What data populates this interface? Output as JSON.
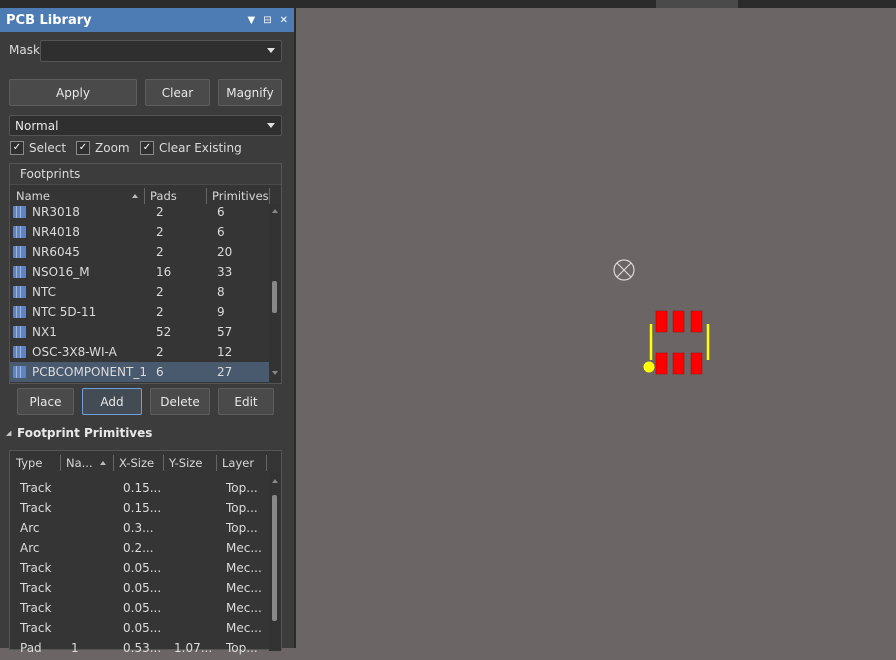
{
  "panel": {
    "title": "PCB Library",
    "controls": [
      "▼",
      "⊟",
      "✕"
    ],
    "mask_label": "Mask",
    "mask_value": "",
    "buttons": {
      "apply": "Apply",
      "clear": "Clear",
      "magnify": "Magnify"
    },
    "mode_value": "Normal",
    "checks": [
      {
        "label": "Select",
        "checked": true
      },
      {
        "label": "Zoom",
        "checked": true
      },
      {
        "label": "Clear Existing",
        "checked": true
      }
    ],
    "footprints": {
      "title": "Footprints",
      "columns": [
        "Name",
        "Pads",
        "Primitives"
      ],
      "rows": [
        {
          "name": "NR3018",
          "pads": "2",
          "primitives": "6"
        },
        {
          "name": "NR4018",
          "pads": "2",
          "primitives": "6"
        },
        {
          "name": "NR6045",
          "pads": "2",
          "primitives": "20"
        },
        {
          "name": "NSO16_M",
          "pads": "16",
          "primitives": "33"
        },
        {
          "name": "NTC",
          "pads": "2",
          "primitives": "8"
        },
        {
          "name": "NTC 5D-11",
          "pads": "2",
          "primitives": "9"
        },
        {
          "name": "NX1",
          "pads": "52",
          "primitives": "57"
        },
        {
          "name": "OSC-3X8-WI-A",
          "pads": "2",
          "primitives": "12"
        },
        {
          "name": "PCBCOMPONENT_1",
          "pads": "6",
          "primitives": "27",
          "selected": true
        }
      ]
    },
    "actions": {
      "place": "Place",
      "add": "Add",
      "delete": "Delete",
      "edit": "Edit"
    },
    "primitives": {
      "title": "Footprint Primitives",
      "collapse_glyph": "◢",
      "columns": [
        "Type",
        "Na...",
        "X-Size",
        "Y-Size",
        "Layer"
      ],
      "rows": [
        {
          "type": "Track",
          "name": "",
          "xsize": "0.15...",
          "ysize": "",
          "layer": "Top..."
        },
        {
          "type": "Track",
          "name": "",
          "xsize": "0.15...",
          "ysize": "",
          "layer": "Top..."
        },
        {
          "type": "Arc",
          "name": "",
          "xsize": "0.3...",
          "ysize": "",
          "layer": "Top..."
        },
        {
          "type": "Arc",
          "name": "",
          "xsize": "0.2...",
          "ysize": "",
          "layer": "Mec..."
        },
        {
          "type": "Track",
          "name": "",
          "xsize": "0.05...",
          "ysize": "",
          "layer": "Mec..."
        },
        {
          "type": "Track",
          "name": "",
          "xsize": "0.05...",
          "ysize": "",
          "layer": "Mec..."
        },
        {
          "type": "Track",
          "name": "",
          "xsize": "0.05...",
          "ysize": "",
          "layer": "Mec..."
        },
        {
          "type": "Track",
          "name": "",
          "xsize": "0.05...",
          "ysize": "",
          "layer": "Mec..."
        },
        {
          "type": "Pad",
          "name": "1",
          "xsize": "0.53...",
          "ysize": "1.07...",
          "layer": "Top..."
        }
      ]
    }
  },
  "colors": {
    "title_bar": "#4d7cb5",
    "canvas_bg": "#6b6665",
    "pad": "#ff0000",
    "silkscreen": "#ffff00",
    "selection": "#49596e"
  }
}
